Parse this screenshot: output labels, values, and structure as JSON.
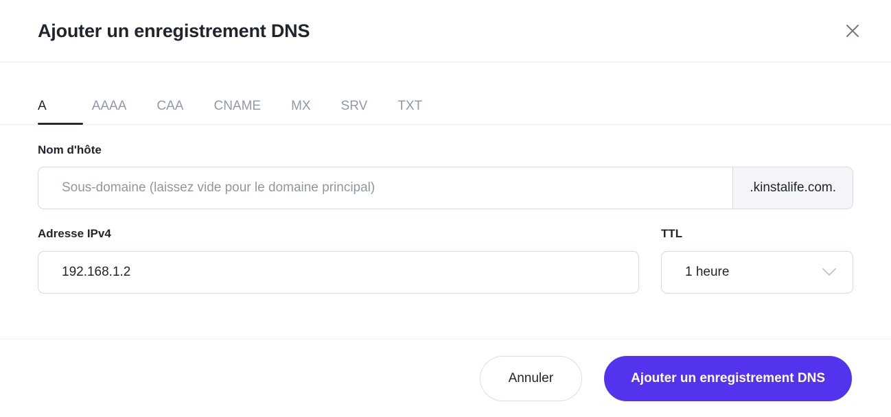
{
  "modal": {
    "title": "Ajouter un enregistrement DNS",
    "close_icon": "close-icon"
  },
  "tabs": {
    "active": "A",
    "items": [
      {
        "label": "A"
      },
      {
        "label": "AAAA"
      },
      {
        "label": "CAA"
      },
      {
        "label": "CNAME"
      },
      {
        "label": "MX"
      },
      {
        "label": "SRV"
      },
      {
        "label": "TXT"
      }
    ]
  },
  "form": {
    "hostname": {
      "label": "Nom d'hôte",
      "placeholder": "Sous-domaine (laissez vide pour le domaine principal)",
      "value": "",
      "suffix": ".kinstalife.com."
    },
    "ipv4": {
      "label": "Adresse IPv4",
      "value": "192.168.1.2",
      "placeholder": ""
    },
    "ttl": {
      "label": "TTL",
      "value": "1 heure",
      "chevron_icon": "chevron-down-icon"
    }
  },
  "footer": {
    "cancel_label": "Annuler",
    "submit_label": "Ajouter un enregistrement DNS"
  },
  "colors": {
    "accent": "#5333ED",
    "text": "#20242C",
    "muted": "#9198A8",
    "border": "#D4DAE4",
    "divider": "#ECEEF1",
    "suffix_bg": "#F3F5F9"
  }
}
